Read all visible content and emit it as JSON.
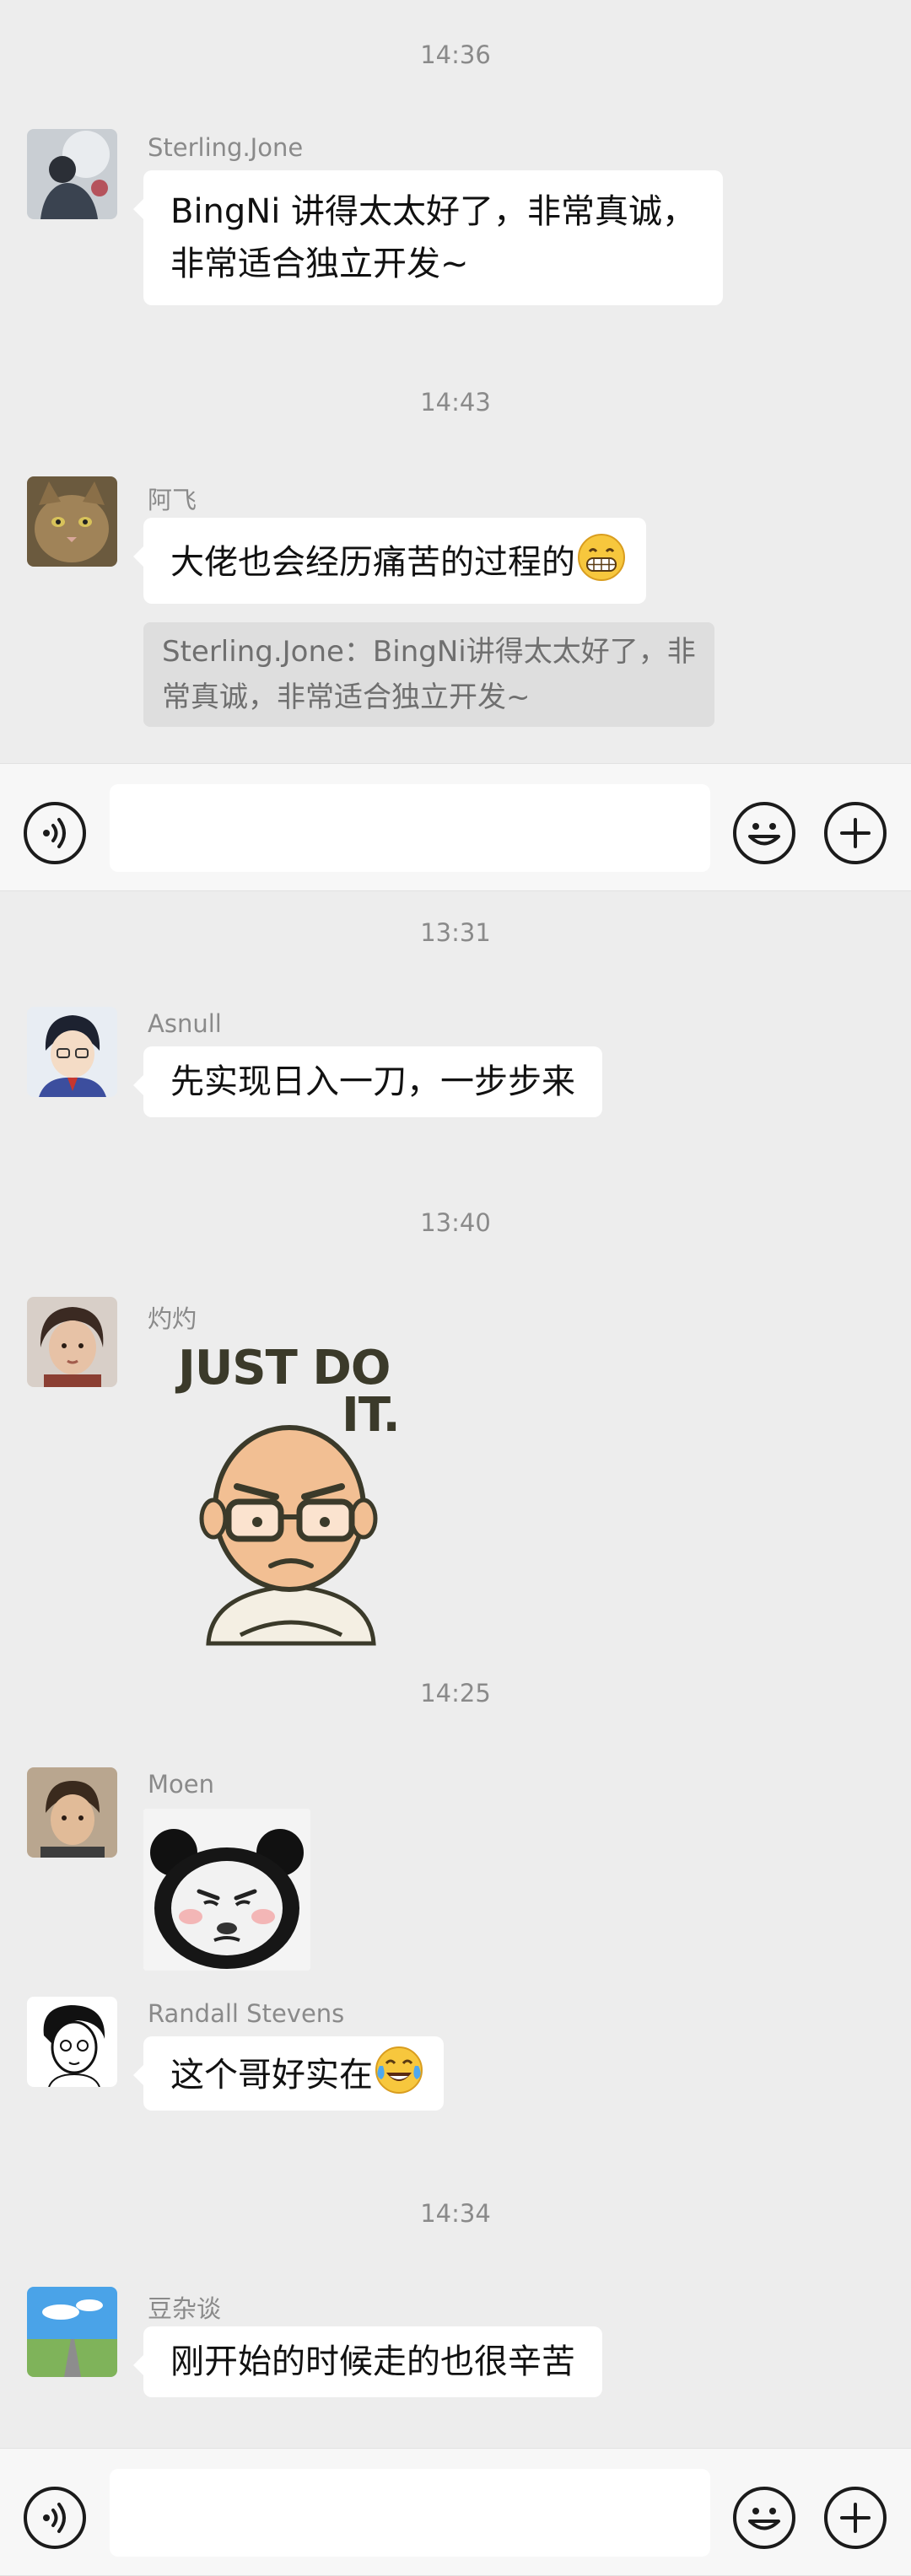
{
  "chat_top": {
    "messages": [
      {
        "timestamp": "14:36",
        "sender": "Sterling.Jone",
        "lines": [
          "BingNi 讲得太太好了，非常真诚，",
          "非常适合独立开发~"
        ]
      },
      {
        "timestamp": "14:43",
        "sender": "阿飞",
        "text": "大佬也会经历痛苦的过程的",
        "emoji": "grin-emoji",
        "quote_lines": [
          "Sterling.Jone：BingNi讲得太太好了，非",
          "常真诚，非常适合独立开发~"
        ]
      }
    ]
  },
  "input_bar": {
    "text": ""
  },
  "chat_bottom": {
    "messages": [
      {
        "timestamp": "13:31",
        "sender": "Asnull",
        "text": "先实现日入一刀，一步步来"
      },
      {
        "timestamp": "13:40",
        "sender": "灼灼",
        "sticker_text_1": "JUST DO",
        "sticker_text_2": "IT."
      },
      {
        "timestamp": "14:25",
        "sender": "Moen",
        "sticker": "panda-face-sticker"
      },
      {
        "sender": "Randall Stevens",
        "text": "这个哥好实在",
        "emoji": "tears-of-joy-emoji"
      },
      {
        "timestamp": "14:34",
        "sender": "豆杂谈",
        "text": "刚开始的时候走的也很辛苦"
      }
    ]
  },
  "colors": {
    "background": "#ededed",
    "bubble": "#ffffff",
    "quote": "#dedede",
    "meta_text": "#8a8a8a"
  }
}
